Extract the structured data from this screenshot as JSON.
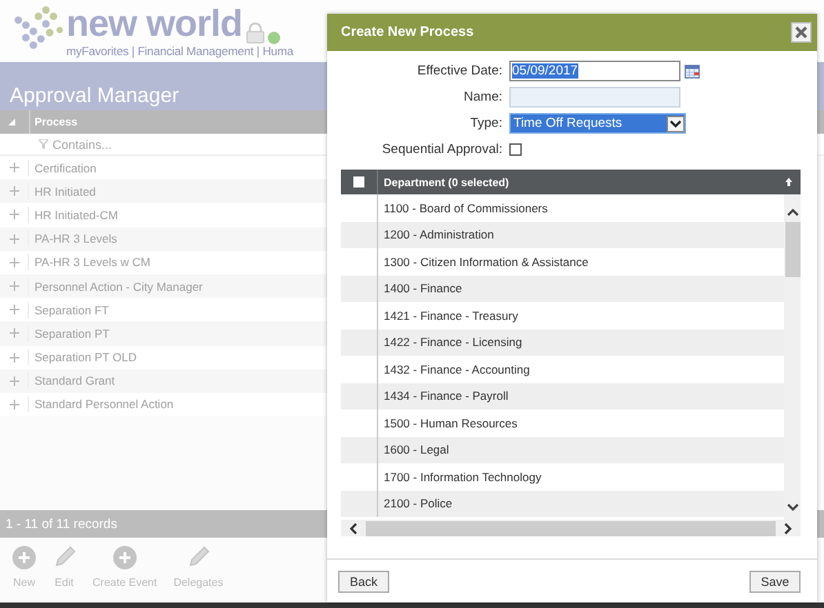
{
  "header": {
    "logo_text": "new world",
    "nav": "myFavorites | Financial Management | Huma"
  },
  "page_title": "Approval Manager",
  "process_table": {
    "column": "Process",
    "filter_placeholder": "Contains...",
    "rows": [
      "Certification",
      "HR Initiated",
      "HR Initiated-CM",
      "PA-HR 3 Levels",
      "PA-HR 3 Levels w CM",
      "Personnel Action - City Manager",
      "Separation FT",
      "Separation PT",
      "Separation PT OLD",
      "Standard Grant",
      "Standard Personnel Action"
    ],
    "footer": "1 - 11 of 11 records"
  },
  "toolbar": [
    {
      "label": "New",
      "kind": "add"
    },
    {
      "label": "Edit",
      "kind": "edit"
    },
    {
      "label": "Create Event",
      "kind": "add"
    },
    {
      "label": "Delegates",
      "kind": "edit"
    }
  ],
  "dialog": {
    "title": "Create New Process",
    "effective_date": {
      "label": "Effective Date:",
      "value": "05/09/2017",
      "text_selected": true
    },
    "name": {
      "label": "Name:"
    },
    "type": {
      "label": "Type:",
      "value": "Time Off Requests",
      "focused": true
    },
    "sequential": {
      "label": "Sequential Approval:",
      "checked": false
    },
    "grid": {
      "header": "Department (0 selected)",
      "all_checked": false,
      "rows": [
        "1100 - Board of Commissioners",
        "1200 - Administration",
        "1300 - Citizen Information & Assistance",
        "1400 - Finance",
        "1421 - Finance - Treasury",
        "1422 - Finance - Licensing",
        "1432 - Finance - Accounting",
        "1434 - Finance - Payroll",
        "1500 - Human Resources",
        "1600 - Legal",
        "1700 - Information Technology",
        "2100 - Police"
      ]
    },
    "buttons": [
      "Back",
      "Save"
    ]
  }
}
